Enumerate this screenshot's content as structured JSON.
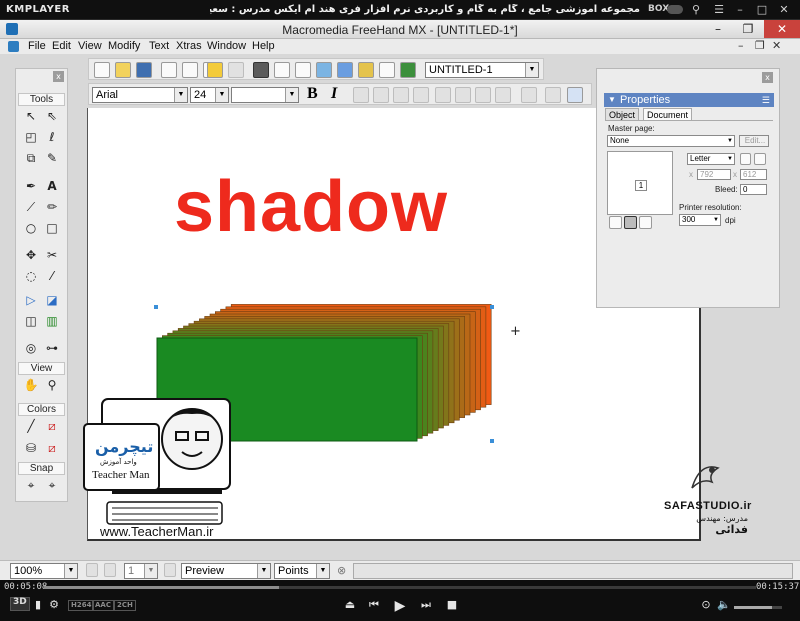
{
  "player": {
    "logo": "KMPLAYER",
    "caption": "مجموعه آموزشی جامع ، گام به گام و کاربردی نرم افزار فری هند ام ایکس   مدرس : سعید فدایی ( تیچرمن ) گروه آموزشی پادشاه گرافیست ها",
    "box_label": "BOX",
    "time_elapsed": "00:05:08",
    "time_total": "00:15:37",
    "progress": 0.33,
    "volume": 0.8,
    "badges": [
      "3D",
      "H264",
      "AAC",
      "2CH"
    ]
  },
  "window": {
    "title": "Macromedia FreeHand MX - [UNTITLED-1*]",
    "min": "–",
    "max": "❐",
    "close": "✕"
  },
  "menu": [
    "File",
    "Edit",
    "View",
    "Modify",
    "Text",
    "Xtras",
    "Window",
    "Help"
  ],
  "toolbar": {
    "doc_name": "UNTITLED-1",
    "font": "Arial",
    "size": "24",
    "bold": "B",
    "italic": "I"
  },
  "tools_panel": {
    "close": "x",
    "sections": [
      "Tools",
      "View",
      "Colors",
      "Snap"
    ]
  },
  "canvas": {
    "text": "shadow",
    "crosshair": "+"
  },
  "watermark": {
    "url": "www.TeacherMan.ir",
    "logo_script": "تیچرمن",
    "logo_tagline": "واحد آموزش",
    "logo_en": "Teacher Man",
    "studio": "SAFASTUDIO.ir",
    "teacher_label": "مدرس: مهندس",
    "teacher_name": "فدائی"
  },
  "properties": {
    "title": "Properties",
    "tabs": [
      "Object",
      "Document"
    ],
    "master_page_label": "Master page:",
    "master_page_value": "None",
    "edit_button": "Edit...",
    "page_number": "1",
    "page_size": "Letter",
    "x_label": "x",
    "width": "792",
    "height": "612",
    "bleed_label": "Bleed:",
    "bleed_value": "0",
    "printer_res_label": "Printer resolution:",
    "printer_res_value": "300",
    "dpi_label": "dpi",
    "close": "x"
  },
  "status": {
    "zoom": "100%",
    "page": "1",
    "view_mode": "Preview",
    "units": "Points"
  },
  "colors": {
    "shadow_text": "#ee2a1d",
    "block_front": "#1a8a22",
    "block_back_start": "#2f8a1f",
    "block_back_end": "#f05a14",
    "accent": "#5e84c2"
  }
}
